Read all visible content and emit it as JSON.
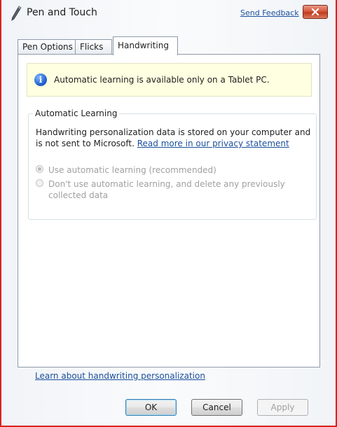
{
  "window": {
    "title": "Pen and Touch",
    "feedback_link": "Send Feedback",
    "close_icon": "close-icon",
    "app_icon": "pen-icon",
    "border_color": "#d9241f"
  },
  "tabs": [
    {
      "label": "Pen Options",
      "active": false
    },
    {
      "label": "Flicks",
      "active": false
    },
    {
      "label": "Handwriting",
      "active": true
    }
  ],
  "info_bar": {
    "icon": "info-icon",
    "text": "Automatic learning is available only on a Tablet PC."
  },
  "automatic_learning": {
    "legend": "Automatic Learning",
    "description": "Handwriting personalization data is stored on your computer and is not sent to Microsoft.",
    "privacy_link": "Read more in our privacy statement",
    "options": [
      {
        "label": "Use automatic learning (recommended)",
        "checked": true,
        "enabled": false
      },
      {
        "label_line1": "Don't use automatic learning, and delete any previously",
        "label_line2": "collected data",
        "checked": false,
        "enabled": false
      }
    ]
  },
  "learn_link": "Learn about handwriting personalization",
  "buttons": {
    "ok": "OK",
    "cancel": "Cancel",
    "apply": "Apply"
  },
  "colors": {
    "link": "#1a4f9c",
    "info_background": "#ffffe1",
    "disabled_text": "#a0a0a0"
  }
}
